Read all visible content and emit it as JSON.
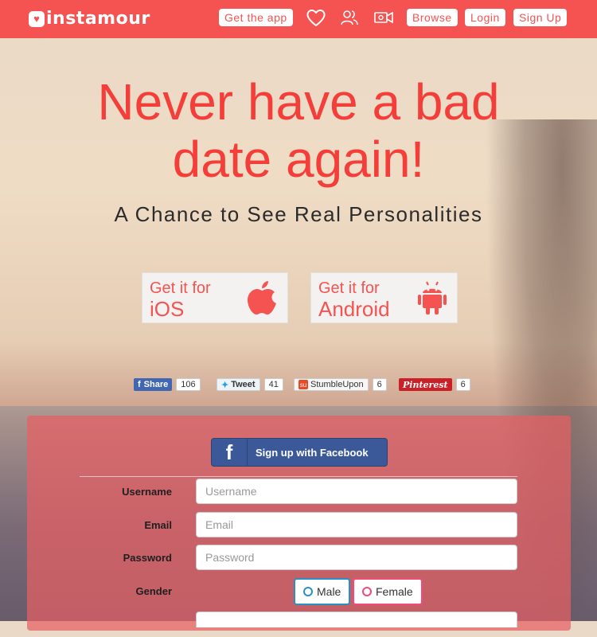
{
  "brand": {
    "name": "instamour"
  },
  "nav": {
    "get_app": "Get the app",
    "browse": "Browse",
    "login": "Login",
    "signup": "Sign Up"
  },
  "hero": {
    "title_line1": "Never have a bad",
    "title_line2": "date again!",
    "subtitle": "A Chance to See Real Personalities"
  },
  "stores": {
    "ios": {
      "line1": "Get it for",
      "line2": "iOS",
      "icon": "apple-icon"
    },
    "android": {
      "line1": "Get it for",
      "line2": "Android",
      "icon": "android-icon"
    }
  },
  "share": {
    "facebook": {
      "label": "Share",
      "count": "106"
    },
    "twitter": {
      "label": "Tweet",
      "count": "41"
    },
    "stumbleupon": {
      "label": "StumbleUpon",
      "count": "6"
    },
    "pinterest": {
      "label": "Pinterest",
      "count": "6"
    }
  },
  "form": {
    "facebook_button": "Sign up with Facebook",
    "username": {
      "label": "Username",
      "placeholder": "Username",
      "value": ""
    },
    "email": {
      "label": "Email",
      "placeholder": "Email",
      "value": ""
    },
    "password": {
      "label": "Password",
      "placeholder": "Password",
      "value": ""
    },
    "gender": {
      "label": "Gender",
      "options": [
        "Male",
        "Female"
      ]
    }
  },
  "colors": {
    "brand_red": "#f45352",
    "facebook_blue": "#3b5998",
    "male_accent": "#2a8fc5",
    "female_accent": "#f24a7a"
  }
}
